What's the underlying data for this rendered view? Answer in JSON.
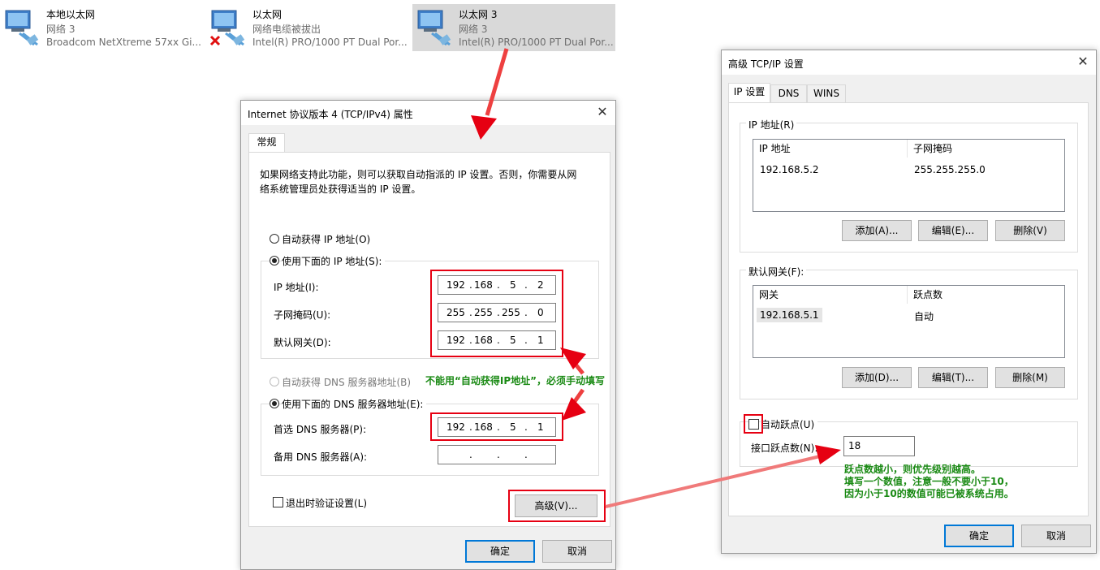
{
  "adapters": [
    {
      "name": "本地以太网",
      "network": "网络 3",
      "device": "Broadcom NetXtreme 57xx Gi...",
      "disconnected": false,
      "selected": false
    },
    {
      "name": "以太网",
      "network": "网络电缆被拔出",
      "device": "Intel(R) PRO/1000 PT Dual Por...",
      "disconnected": true,
      "selected": false
    },
    {
      "name": "以太网 3",
      "network": "网络 3",
      "device": "Intel(R) PRO/1000 PT Dual Por...",
      "disconnected": false,
      "selected": true
    }
  ],
  "ipv4_dialog": {
    "title": "Internet 协议版本 4 (TCP/IPv4) 属性",
    "tab_general": "常规",
    "description_line1": "如果网络支持此功能，则可以获取自动指派的 IP 设置。否则，你需要从网",
    "description_line2": "络系统管理员处获得适当的 IP 设置。",
    "auto_ip_label": "自动获得 IP 地址(O)",
    "manual_ip_label": "使用下面的 IP 地址(S):",
    "ip_label": "IP 地址(I):",
    "ip_value": [
      "192",
      "168",
      "5",
      "2"
    ],
    "mask_label": "子网掩码(U):",
    "mask_value": [
      "255",
      "255",
      "255",
      "0"
    ],
    "gateway_label": "默认网关(D):",
    "gateway_value": [
      "192",
      "168",
      "5",
      "1"
    ],
    "auto_dns_label": "自动获得 DNS 服务器地址(B)",
    "manual_dns_label": "使用下面的 DNS 服务器地址(E):",
    "preferred_dns_label": "首选 DNS 服务器(P):",
    "preferred_dns_value": [
      "192",
      "168",
      "5",
      "1"
    ],
    "alternate_dns_label": "备用 DNS 服务器(A):",
    "validate_label": "退出时验证设置(L)",
    "advanced_button": "高级(V)...",
    "ok_button": "确定",
    "cancel_button": "取消"
  },
  "advanced_dialog": {
    "title": "高级 TCP/IP 设置",
    "tabs": [
      "IP 设置",
      "DNS",
      "WINS"
    ],
    "ip_group_label": "IP 地址(R)",
    "ip_col_address": "IP 地址",
    "ip_col_mask": "子网掩码",
    "ip_row_address": "192.168.5.2",
    "ip_row_mask": "255.255.255.0",
    "ip_add": "添加(A)...",
    "ip_edit": "编辑(E)...",
    "ip_delete": "删除(V)",
    "gw_group_label": "默认网关(F):",
    "gw_col_gateway": "网关",
    "gw_col_metric": "跃点数",
    "gw_row_gateway": "192.168.5.1",
    "gw_row_metric": "自动",
    "gw_add": "添加(D)...",
    "gw_edit": "编辑(T)...",
    "gw_delete": "删除(M)",
    "auto_metric_label": "自动跃点(U)",
    "interface_metric_label": "接口跃点数(N):",
    "interface_metric_value": "18",
    "ok_button": "确定",
    "cancel_button": "取消"
  },
  "annotations": {
    "note_no_auto_ip": "不能用“自动获得IP地址”，必须手动填写",
    "note_metric_line1": "跃点数越小，则优先级别越高。",
    "note_metric_line2": "填写一个数值，注意一般不要小于10，",
    "note_metric_line3": "因为小于10的数值可能已被系统占用。"
  },
  "colors": {
    "annotation_red": "#e60012",
    "annotation_green": "#1a8a14",
    "accent_blue": "#0078d7"
  }
}
